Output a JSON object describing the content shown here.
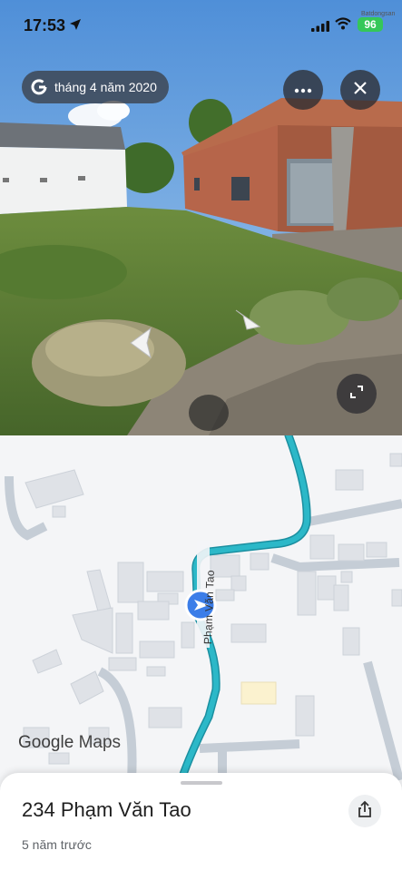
{
  "status_bar": {
    "time": "17:53",
    "battery": "96",
    "carrier_watermark": "Batdongsan"
  },
  "street_view": {
    "date_label": "tháng 4 năm 2020",
    "watermark": "Batdongsan",
    "icons": [
      "google-g-icon",
      "more-dots-icon",
      "close-icon",
      "nav-arrow-left-icon",
      "nav-arrow-right-icon",
      "expand-icon"
    ]
  },
  "map": {
    "street_label": "Phạm Văn Tao",
    "logo_google": "Google",
    "logo_maps": "Maps",
    "road_color": "#2cb8c8",
    "marker_color": "#3b7de8"
  },
  "sheet": {
    "address": "234 Phạm Văn Tao",
    "age": "5 năm trước"
  }
}
